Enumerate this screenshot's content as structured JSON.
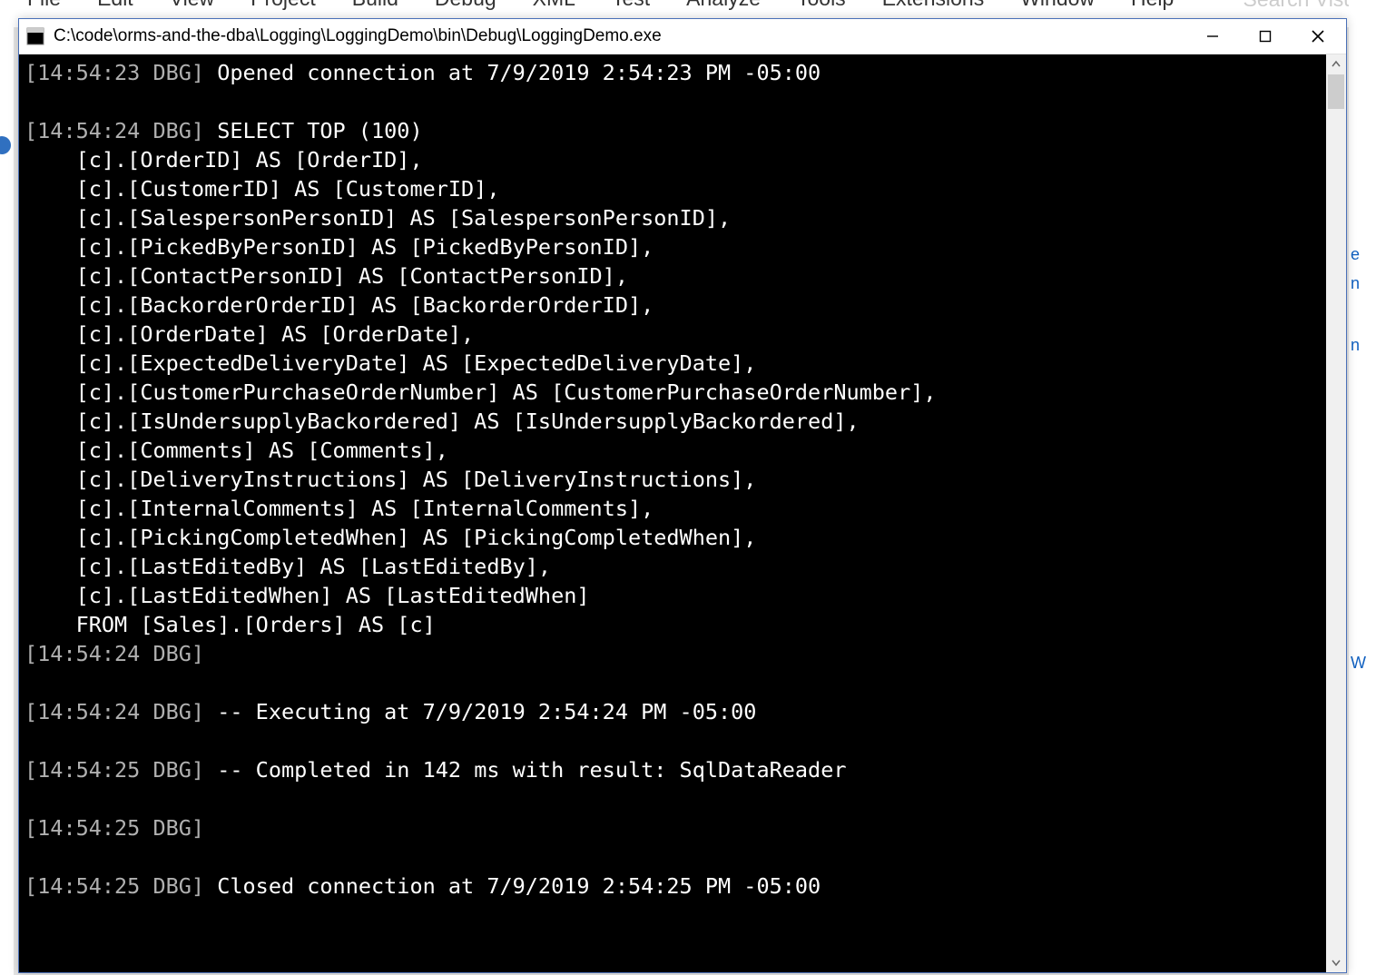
{
  "bg_menu": {
    "items": [
      "File",
      "Edit",
      "View",
      "Project",
      "Build",
      "Debug",
      "XML",
      "Test",
      "Analyze",
      "Tools",
      "Extensions",
      "Window",
      "Help"
    ],
    "search_placeholder": "Search Visual"
  },
  "bg_right_stubs": [
    "e",
    "n",
    "n",
    "W"
  ],
  "window": {
    "title": "C:\\code\\orms-and-the-dba\\Logging\\LoggingDemo\\bin\\Debug\\LoggingDemo.exe",
    "controls": {
      "minimize": "Minimize",
      "maximize": "Maximize",
      "close": "Close"
    }
  },
  "timestamp_color": "#b0b0b0",
  "log": [
    {
      "ts": "[14:54:23 DBG]",
      "msg": " Opened connection at 7/9/2019 2:54:23 PM -05:00"
    },
    {
      "ts": "",
      "msg": ""
    },
    {
      "ts": "[14:54:24 DBG]",
      "msg": " SELECT TOP (100)"
    },
    {
      "ts": "",
      "msg": "    [c].[OrderID] AS [OrderID],"
    },
    {
      "ts": "",
      "msg": "    [c].[CustomerID] AS [CustomerID],"
    },
    {
      "ts": "",
      "msg": "    [c].[SalespersonPersonID] AS [SalespersonPersonID],"
    },
    {
      "ts": "",
      "msg": "    [c].[PickedByPersonID] AS [PickedByPersonID],"
    },
    {
      "ts": "",
      "msg": "    [c].[ContactPersonID] AS [ContactPersonID],"
    },
    {
      "ts": "",
      "msg": "    [c].[BackorderOrderID] AS [BackorderOrderID],"
    },
    {
      "ts": "",
      "msg": "    [c].[OrderDate] AS [OrderDate],"
    },
    {
      "ts": "",
      "msg": "    [c].[ExpectedDeliveryDate] AS [ExpectedDeliveryDate],"
    },
    {
      "ts": "",
      "msg": "    [c].[CustomerPurchaseOrderNumber] AS [CustomerPurchaseOrderNumber],"
    },
    {
      "ts": "",
      "msg": "    [c].[IsUndersupplyBackordered] AS [IsUndersupplyBackordered],"
    },
    {
      "ts": "",
      "msg": "    [c].[Comments] AS [Comments],"
    },
    {
      "ts": "",
      "msg": "    [c].[DeliveryInstructions] AS [DeliveryInstructions],"
    },
    {
      "ts": "",
      "msg": "    [c].[InternalComments] AS [InternalComments],"
    },
    {
      "ts": "",
      "msg": "    [c].[PickingCompletedWhen] AS [PickingCompletedWhen],"
    },
    {
      "ts": "",
      "msg": "    [c].[LastEditedBy] AS [LastEditedBy],"
    },
    {
      "ts": "",
      "msg": "    [c].[LastEditedWhen] AS [LastEditedWhen]"
    },
    {
      "ts": "",
      "msg": "    FROM [Sales].[Orders] AS [c]"
    },
    {
      "ts": "[14:54:24 DBG]",
      "msg": ""
    },
    {
      "ts": "",
      "msg": ""
    },
    {
      "ts": "[14:54:24 DBG]",
      "msg": " -- Executing at 7/9/2019 2:54:24 PM -05:00"
    },
    {
      "ts": "",
      "msg": ""
    },
    {
      "ts": "[14:54:25 DBG]",
      "msg": " -- Completed in 142 ms with result: SqlDataReader"
    },
    {
      "ts": "",
      "msg": ""
    },
    {
      "ts": "[14:54:25 DBG]",
      "msg": ""
    },
    {
      "ts": "",
      "msg": ""
    },
    {
      "ts": "[14:54:25 DBG]",
      "msg": " Closed connection at 7/9/2019 2:54:25 PM -05:00"
    }
  ]
}
